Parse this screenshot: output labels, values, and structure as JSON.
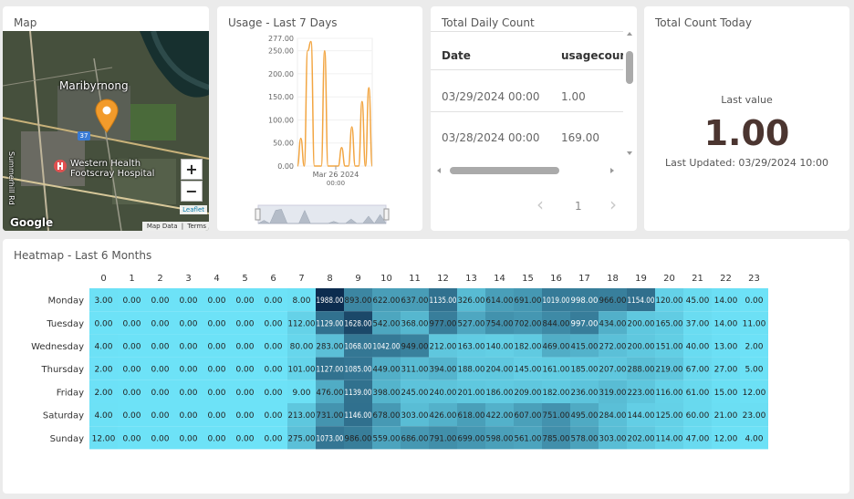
{
  "map": {
    "title": "Map",
    "labels": {
      "area": "Maribyrnong",
      "hospital_line1": "Western Health",
      "hospital_line2": "Footscray Hospital",
      "road": "Summerhill Rd",
      "route": "37"
    },
    "zoom_in": "+",
    "zoom_out": "−",
    "google": "Google",
    "leaflet": "Leaflet",
    "map_data": "Map Data",
    "terms": "Terms"
  },
  "usage": {
    "title": "Usage - Last 7 Days",
    "chart_data": {
      "type": "line",
      "title": "",
      "yticks": [
        "277.00",
        "250.00",
        "200.00",
        "150.00",
        "100.00",
        "50.00",
        "0.00"
      ],
      "ylim": [
        0,
        277
      ],
      "xtick_label": "Mar 26 2024",
      "xtick_sublabel": "00:00",
      "series": [
        {
          "values": [
            0,
            60,
            0,
            250,
            270,
            0,
            0,
            0,
            250,
            0,
            0,
            0,
            0,
            40,
            0,
            0,
            85,
            0,
            0,
            140,
            0,
            170,
            0
          ]
        }
      ],
      "color": "#f2a541"
    }
  },
  "table": {
    "title": "Total Daily Count",
    "columns": [
      "Date",
      "usagecount"
    ],
    "rows": [
      [
        "03/29/2024 00:00",
        "1.00"
      ],
      [
        "03/28/2024 00:00",
        "169.00"
      ]
    ],
    "page": "1",
    "prev": "‹",
    "next": "›"
  },
  "kpi": {
    "title": "Total Count Today",
    "label": "Last value",
    "value": "1.00",
    "updated": "Last Updated: 03/29/2024 10:00",
    "value_color": "#4b3530"
  },
  "heatmap": {
    "title": "Heatmap - Last 6 Months",
    "chart_data": {
      "type": "heatmap",
      "x": [
        "0",
        "1",
        "2",
        "3",
        "4",
        "5",
        "6",
        "7",
        "8",
        "9",
        "10",
        "11",
        "12",
        "13",
        "14",
        "15",
        "16",
        "17",
        "18",
        "19",
        "20",
        "21",
        "22",
        "23"
      ],
      "y": [
        "Monday",
        "Tuesday",
        "Wednesday",
        "Thursday",
        "Friday",
        "Saturday",
        "Sunday"
      ],
      "values": [
        [
          3,
          0,
          0,
          0,
          0,
          0,
          0,
          8,
          1988,
          893,
          622,
          637,
          1135,
          326,
          614,
          691,
          1019,
          998,
          966,
          1154,
          120,
          45,
          14,
          0
        ],
        [
          0,
          0,
          0,
          0,
          0,
          0,
          0,
          112,
          1129,
          1628,
          542,
          368,
          977,
          527,
          754,
          702,
          844,
          997,
          434,
          200,
          165,
          37,
          14,
          11
        ],
        [
          4,
          0,
          0,
          0,
          0,
          0,
          0,
          80,
          283,
          1068,
          1042,
          949,
          212,
          163,
          140,
          182,
          469,
          415,
          272,
          200,
          151,
          40,
          13,
          2
        ],
        [
          2,
          0,
          0,
          0,
          0,
          0,
          0,
          101,
          1127,
          1085,
          449,
          311,
          394,
          188,
          204,
          145,
          161,
          185,
          207,
          288,
          219,
          67,
          27,
          5
        ],
        [
          2,
          0,
          0,
          0,
          0,
          0,
          0,
          9,
          476,
          1139,
          398,
          245,
          240,
          201,
          186,
          209,
          182,
          236,
          319,
          223,
          116,
          61,
          15,
          12
        ],
        [
          4,
          0,
          0,
          0,
          0,
          0,
          0,
          213,
          731,
          1146,
          678,
          303,
          426,
          618,
          422,
          607,
          751,
          495,
          284,
          144,
          125,
          60,
          21,
          23
        ],
        [
          12,
          0,
          0,
          0,
          0,
          0,
          0,
          275,
          1073,
          986,
          559,
          686,
          791,
          699,
          598,
          561,
          785,
          578,
          303,
          202,
          114,
          47,
          12,
          4
        ]
      ],
      "labels": [
        [
          "3.00",
          "0.00",
          "0.00",
          "0.00",
          "0.00",
          "0.00",
          "0.00",
          "8.00",
          "1988.00",
          "893.00",
          "622.00",
          "637.00",
          "1135.00",
          "326.00",
          "614.00",
          "691.00",
          "1019.00",
          "998.00",
          "966.00",
          "1154.00",
          "120.00",
          "45.00",
          "14.00",
          "0.00"
        ],
        [
          "0.00",
          "0.00",
          "0.00",
          "0.00",
          "0.00",
          "0.00",
          "0.00",
          "112.00",
          "1129.00",
          "1628.00",
          "542.00",
          "368.00",
          "977.00",
          "527.00",
          "754.00",
          "702.00",
          "844.00",
          "997.00",
          "434.00",
          "200.00",
          "165.00",
          "37.00",
          "14.00",
          "11.00"
        ],
        [
          "4.00",
          "0.00",
          "0.00",
          "0.00",
          "0.00",
          "0.00",
          "0.00",
          "80.00",
          "283.00",
          "1068.00",
          "1042.00",
          "949.00",
          "212.00",
          "163.00",
          "140.00",
          "182.00",
          "469.00",
          "415.00",
          "272.00",
          "200.00",
          "151.00",
          "40.00",
          "13.00",
          "2.00"
        ],
        [
          "2.00",
          "0.00",
          "0.00",
          "0.00",
          "0.00",
          "0.00",
          "0.00",
          "101.00",
          "1127.00",
          "1085.00",
          "449.00",
          "311.00",
          "394.00",
          "188.00",
          "204.00",
          "145.00",
          "161.00",
          "185.00",
          "207.00",
          "288.00",
          "219.00",
          "67.00",
          "27.00",
          "5.00"
        ],
        [
          "2.00",
          "0.00",
          "0.00",
          "0.00",
          "0.00",
          "0.00",
          "0.00",
          "9.00",
          "476.00",
          "1139.00",
          "398.00",
          "245.00",
          "240.00",
          "201.00",
          "186.00",
          "209.00",
          "182.00",
          "236.00",
          "319.00",
          "223.00",
          "116.00",
          "61.00",
          "15.00",
          "12.00"
        ],
        [
          "4.00",
          "0.00",
          "0.00",
          "0.00",
          "0.00",
          "0.00",
          "0.00",
          "213.00",
          "731.00",
          "1146.00",
          "678.00",
          "303.00",
          "426.00",
          "618.00",
          "422.00",
          "607.00",
          "751.00",
          "495.00",
          "284.00",
          "144.00",
          "125.00",
          "60.00",
          "21.00",
          "23.00"
        ],
        [
          "12.00",
          "0.00",
          "0.00",
          "0.00",
          "0.00",
          "0.00",
          "0.00",
          "275.00",
          "1073.00",
          "986.00",
          "559.00",
          "686.00",
          "791.00",
          "699.00",
          "598.00",
          "561.00",
          "785.00",
          "578.00",
          "303.00",
          "202.00",
          "114.00",
          "47.00",
          "12.00",
          "4.00"
        ]
      ],
      "color_low": "#6de2f7",
      "color_high": "#0c2c4f",
      "max": 1988
    }
  }
}
